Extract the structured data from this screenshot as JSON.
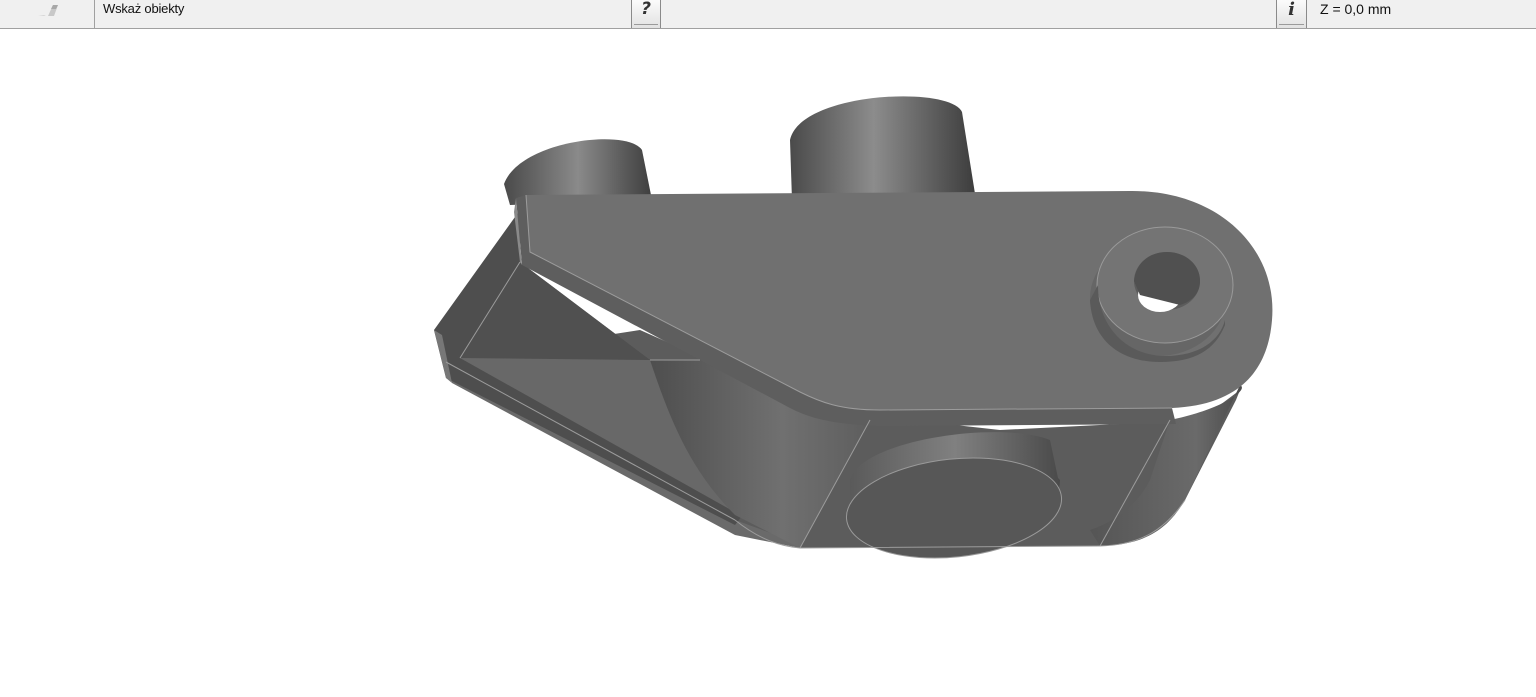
{
  "statusbar": {
    "tool_icon": "pencil-icon",
    "prompt": "Wskaż obiekty",
    "help_glyph": "?",
    "info_glyph": "i",
    "coordinate": "Z = 0,0 mm"
  },
  "viewport": {
    "model": "3d-part-model",
    "shade_color": "#6e6e6e",
    "edge_color": "#9c9c9c"
  }
}
